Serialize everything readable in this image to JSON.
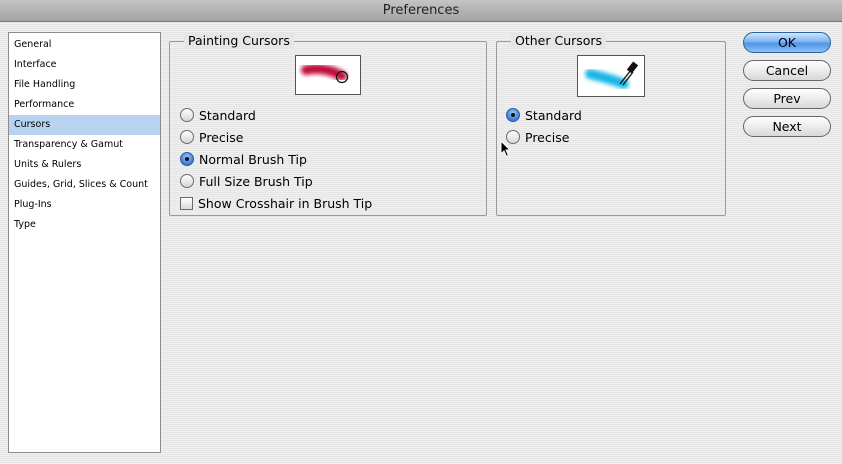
{
  "window": {
    "title": "Preferences"
  },
  "sidebar": {
    "items": [
      {
        "label": "General",
        "selected": false
      },
      {
        "label": "Interface",
        "selected": false
      },
      {
        "label": "File Handling",
        "selected": false
      },
      {
        "label": "Performance",
        "selected": false
      },
      {
        "label": "Cursors",
        "selected": true
      },
      {
        "label": "Transparency & Gamut",
        "selected": false
      },
      {
        "label": "Units & Rulers",
        "selected": false
      },
      {
        "label": "Guides, Grid, Slices & Count",
        "selected": false
      },
      {
        "label": "Plug-Ins",
        "selected": false
      },
      {
        "label": "Type",
        "selected": false
      }
    ]
  },
  "painting_cursors": {
    "title": "Painting Cursors",
    "options": [
      {
        "label": "Standard",
        "type": "radio",
        "checked": false
      },
      {
        "label": "Precise",
        "type": "radio",
        "checked": false
      },
      {
        "label": "Normal Brush Tip",
        "type": "radio",
        "checked": true
      },
      {
        "label": "Full Size Brush Tip",
        "type": "radio",
        "checked": false
      },
      {
        "label": "Show Crosshair in Brush Tip",
        "type": "checkbox",
        "checked": false
      }
    ]
  },
  "other_cursors": {
    "title": "Other Cursors",
    "options": [
      {
        "label": "Standard",
        "type": "radio",
        "checked": true
      },
      {
        "label": "Precise",
        "type": "radio",
        "checked": false
      }
    ]
  },
  "buttons": {
    "ok": "OK",
    "cancel": "Cancel",
    "prev": "Prev",
    "next": "Next"
  },
  "colors": {
    "selection": "#b8d3f0",
    "brush_stroke": "#c0103a",
    "eyedropper_stroke": "#19b6e6"
  },
  "icons": {
    "painting_preview": "brush-stroke-preview",
    "other_preview": "eyedropper-preview"
  }
}
